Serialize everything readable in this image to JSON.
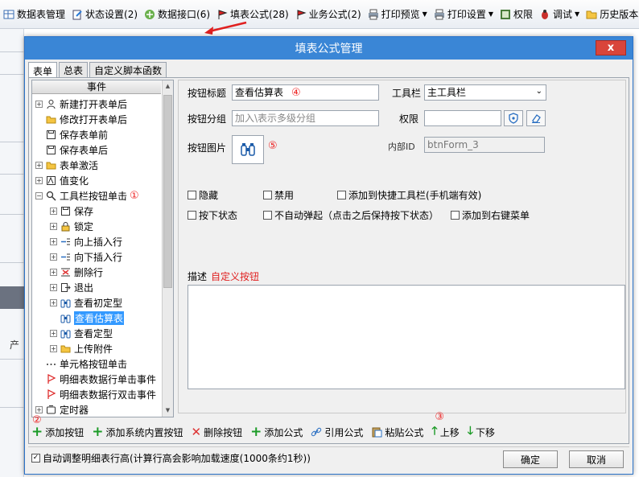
{
  "toolbar": {
    "items": [
      {
        "label": "数据表管理",
        "icon": "table-icon"
      },
      {
        "label": "状态设置(2)",
        "icon": "status-icon"
      },
      {
        "label": "数据接口(6)",
        "icon": "interface-icon"
      },
      {
        "label": "填表公式(28)",
        "icon": "flag-icon"
      },
      {
        "label": "业务公式(2)",
        "icon": "flag-icon"
      },
      {
        "label": "打印预览",
        "icon": "printer-icon"
      },
      {
        "label": "打印设置",
        "icon": "printer-icon"
      },
      {
        "label": "权限",
        "icon": "permission-icon"
      },
      {
        "label": "调试",
        "icon": "bug-icon"
      },
      {
        "label": "历史版本",
        "icon": "folder-icon"
      }
    ]
  },
  "background": {
    "partial_label": "产"
  },
  "dialog": {
    "title": "填表公式管理",
    "close_label": "x",
    "tabs": [
      "表单",
      "总表",
      "自定义脚本函数"
    ],
    "tree": {
      "header": "事件",
      "nodes": [
        {
          "label": "新建打开表单后",
          "level": 0,
          "expander": "+",
          "icon": "user-icon"
        },
        {
          "label": "修改打开表单后",
          "level": 0,
          "expander": "",
          "icon": "folder-icon"
        },
        {
          "label": "保存表单前",
          "level": 0,
          "expander": "",
          "icon": "save-icon"
        },
        {
          "label": "保存表单后",
          "level": 0,
          "expander": "",
          "icon": "save-icon"
        },
        {
          "label": "表单激活",
          "level": 0,
          "expander": "+",
          "icon": "folder-icon"
        },
        {
          "label": "值变化",
          "level": 0,
          "expander": "+",
          "icon": "value-change-icon"
        },
        {
          "label": "工具栏按钮单击",
          "level": 0,
          "expander": "-",
          "icon": "magnifier-icon",
          "callout": "①"
        },
        {
          "label": "保存",
          "level": 1,
          "expander": "+",
          "icon": "save-icon"
        },
        {
          "label": "锁定",
          "level": 1,
          "expander": "+",
          "icon": "lock-icon"
        },
        {
          "label": "向上插入行",
          "level": 1,
          "expander": "+",
          "icon": "insert-row-icon"
        },
        {
          "label": "向下插入行",
          "level": 1,
          "expander": "+",
          "icon": "insert-row-icon"
        },
        {
          "label": "删除行",
          "level": 1,
          "expander": "+",
          "icon": "delete-row-icon"
        },
        {
          "label": "退出",
          "level": 1,
          "expander": "+",
          "icon": "exit-icon"
        },
        {
          "label": "查看初定型",
          "level": 1,
          "expander": "+",
          "icon": "binoculars-icon"
        },
        {
          "label": "查看估算表",
          "level": 1,
          "expander": "",
          "icon": "binoculars-icon",
          "selected": true
        },
        {
          "label": "查看定型",
          "level": 1,
          "expander": "+",
          "icon": "binoculars-icon"
        },
        {
          "label": "上传附件",
          "level": 1,
          "expander": "+",
          "icon": "folder-icon"
        },
        {
          "label": "单元格按钮单击",
          "level": 0,
          "expander": "",
          "icon": "dots-icon"
        },
        {
          "label": "明细表数据行单击事件",
          "level": 0,
          "expander": "",
          "icon": "red-flag-icon"
        },
        {
          "label": "明细表数据行双击事件",
          "level": 0,
          "expander": "",
          "icon": "red-flag-icon"
        },
        {
          "label": "定时器",
          "level": 0,
          "expander": "+",
          "icon": "timer-icon"
        }
      ]
    },
    "form": {
      "button_title_label": "按钮标题",
      "button_title_value": "查看估算表",
      "button_title_callout": "④",
      "toolbar_label": "工具栏",
      "toolbar_value": "主工具栏",
      "button_group_label": "按钮分组",
      "button_group_placeholder": "加入\\表示多级分组",
      "permission_label": "权限",
      "permission_value": "",
      "button_image_label": "按钮图片",
      "button_image_callout": "⑤",
      "internal_id_label": "内部ID",
      "internal_id_value": "btnForm_3",
      "checkboxes": [
        {
          "label": "隐藏",
          "checked": false
        },
        {
          "label": "禁用",
          "checked": false
        },
        {
          "label": "添加到快捷工具栏(手机端有效)",
          "checked": false
        },
        {
          "label": "按下状态",
          "checked": false
        },
        {
          "label": "不自动弹起（点击之后保持按下状态）",
          "checked": false
        },
        {
          "label": "添加到右键菜单",
          "checked": false
        }
      ],
      "desc_label": "描述",
      "desc_value": "自定义按钮",
      "desc_color": "#e02020"
    },
    "actions": [
      {
        "label": "添加按钮",
        "icon": "plus-icon",
        "callout": "②"
      },
      {
        "label": "添加系统内置按钮",
        "icon": "plus-icon"
      },
      {
        "label": "删除按钮",
        "icon": "delete-icon"
      },
      {
        "label": "添加公式",
        "icon": "plus-icon"
      },
      {
        "label": "引用公式",
        "icon": "link-icon"
      },
      {
        "label": "粘贴公式",
        "icon": "paste-icon"
      },
      {
        "label": "上移",
        "icon": "arrow-up-icon",
        "callout": "③"
      },
      {
        "label": "下移",
        "icon": "arrow-down-icon"
      }
    ],
    "auto_adjust_label": "自动调整明细表行高(计算行高会影响加载速度(1000条约1秒))",
    "auto_adjust_checked": true,
    "ok_label": "确定",
    "cancel_label": "取消"
  },
  "colors": {
    "titlebar": "#3a86d6",
    "close": "#d9453b",
    "selection": "#3399ff",
    "callout": "#e22222",
    "green": "#1c9b27"
  }
}
